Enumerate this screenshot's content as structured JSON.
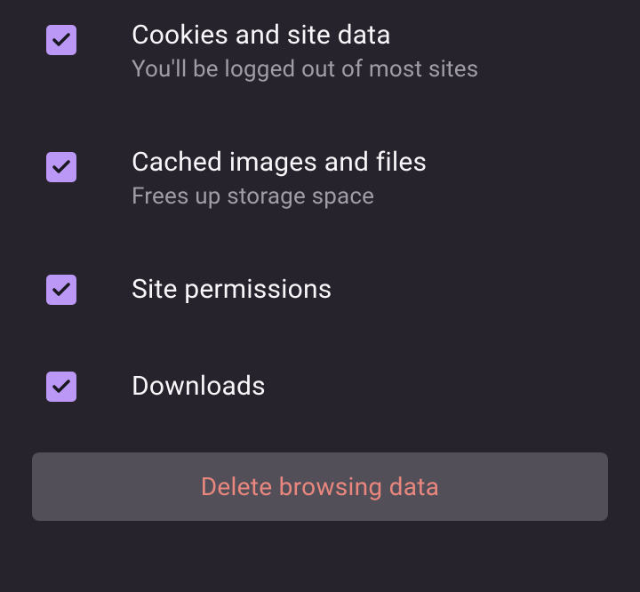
{
  "options": [
    {
      "title": "Cookies and site data",
      "subtitle": "You'll be logged out of most sites",
      "checked": true
    },
    {
      "title": "Cached images and files",
      "subtitle": "Frees up storage space",
      "checked": true
    },
    {
      "title": "Site permissions",
      "subtitle": "",
      "checked": true
    },
    {
      "title": "Downloads",
      "subtitle": "",
      "checked": true
    }
  ],
  "delete_button_label": "Delete browsing data"
}
